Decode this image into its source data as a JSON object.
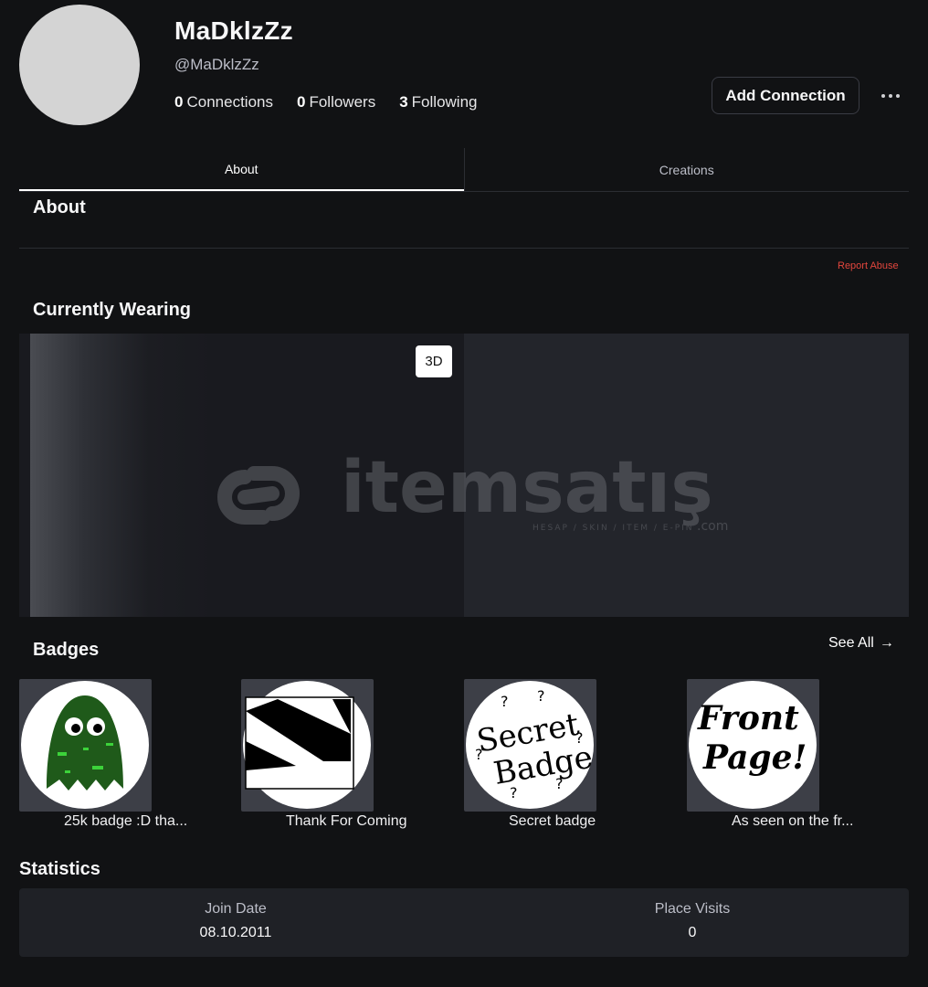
{
  "profile": {
    "display_name": "MaDklzZz",
    "username": "@MaDklzZz",
    "connections_count": "0",
    "connections_label": "Connections",
    "followers_count": "0",
    "followers_label": "Followers",
    "following_count": "3",
    "following_label": "Following"
  },
  "actions": {
    "add_connection_label": "Add Connection"
  },
  "tabs": [
    {
      "label": "About",
      "active": true
    },
    {
      "label": "Creations",
      "active": false
    }
  ],
  "about": {
    "title": "About",
    "report_label": "Report Abuse"
  },
  "wearing": {
    "title": "Currently Wearing",
    "view_3d_label": "3D"
  },
  "watermark": {
    "brand": "itemsatış",
    "tagline": "HESAP / SKIN / ITEM / E-PIN",
    "suffix": ".com"
  },
  "badges": {
    "title": "Badges",
    "see_all_label": "See All",
    "items": [
      {
        "label": "25k badge :D tha..."
      },
      {
        "label": "Thank For Coming"
      },
      {
        "label": "Secret badge",
        "image_text_1": "Secret",
        "image_text_2": "Badge"
      },
      {
        "label": "As seen on the fr...",
        "image_text_1": "Front",
        "image_text_2": "Page!"
      }
    ]
  },
  "statistics": {
    "title": "Statistics",
    "join_date_label": "Join Date",
    "join_date_value": "08.10.2011",
    "place_visits_label": "Place Visits",
    "place_visits_value": "0"
  },
  "colors": {
    "background": "#111214",
    "report_red": "#e2463d",
    "panel": "#1f2126"
  }
}
